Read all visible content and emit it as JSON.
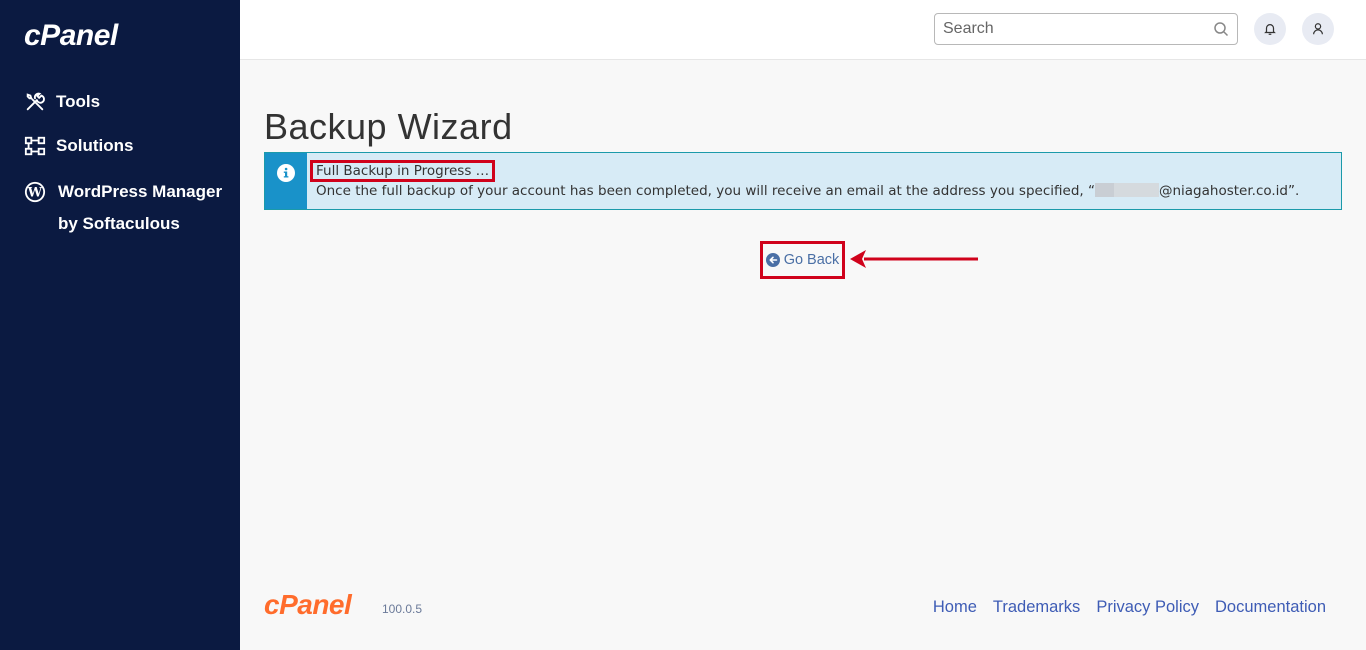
{
  "sidebar": {
    "logo": "cPanel",
    "items": [
      {
        "label": "Tools",
        "icon": "tools-icon"
      },
      {
        "label": "Solutions",
        "icon": "solutions-icon"
      },
      {
        "label": "WordPress Manager by Softaculous",
        "icon": "wordpress-icon"
      }
    ]
  },
  "header": {
    "search_placeholder": "Search",
    "search_value": ""
  },
  "main": {
    "title": "Backup Wizard",
    "alert": {
      "title": "Full Backup in Progress …",
      "message_prefix": "Once the full backup of your account has been completed, you will receive an email at the address you specified, “",
      "message_suffix": "@niagahoster.co.id”."
    },
    "go_back_label": "Go Back"
  },
  "footer": {
    "logo": "cPanel",
    "version": "100.0.5",
    "links": [
      "Home",
      "Trademarks",
      "Privacy Policy",
      "Documentation"
    ]
  },
  "colors": {
    "sidebar_bg": "#0b1a41",
    "alert_bg": "#d7ebf6",
    "alert_icon_bg": "#1992c9",
    "highlight_red": "#d0021b",
    "footer_logo": "#ff6c2c",
    "link": "#3e5cb5"
  }
}
